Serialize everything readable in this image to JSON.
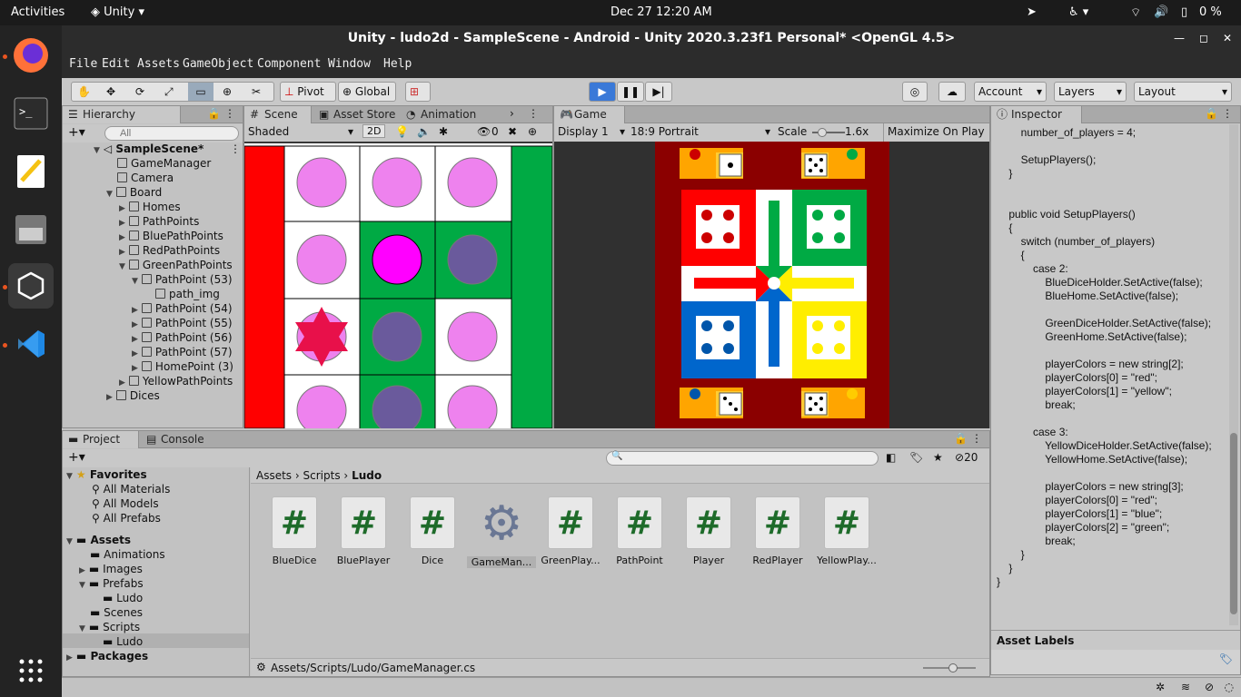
{
  "topbar": {
    "activities": "Activities",
    "app": "Unity",
    "clock": "Dec 27  12:20 AM",
    "battery": "0 %"
  },
  "window": {
    "title": "Unity - ludo2d - SampleScene - Android - Unity 2020.3.23f1 Personal* <OpenGL 4.5>"
  },
  "menu": [
    "File",
    "Edit",
    "Assets",
    "GameObject",
    "Component",
    "Window",
    "Help"
  ],
  "toolbar": {
    "pivot": "Pivot",
    "global": "Global",
    "account": "Account",
    "layers": "Layers",
    "layout": "Layout"
  },
  "hierarchy": {
    "tab": "Hierarchy",
    "search_placeholder": "All",
    "items": [
      "SampleScene*",
      "GameManager",
      "Camera",
      "Board",
      "Homes",
      "PathPoints",
      "BluePathPoints",
      "RedPathPoints",
      "GreenPathPoints",
      "PathPoint (53)",
      "path_img",
      "PathPoint (54)",
      "PathPoint (55)",
      "PathPoint (56)",
      "PathPoint (57)",
      "HomePoint (3)",
      "YellowPathPoints",
      "Dices"
    ]
  },
  "scene": {
    "tabs": [
      "Scene",
      "Asset Store",
      "Animation"
    ],
    "shading": "Shaded",
    "mode2d": "2D",
    "hidden": "0"
  },
  "game": {
    "tab": "Game",
    "display": "Display 1",
    "aspect": "18:9 Portrait",
    "scale_label": "Scale",
    "scale_value": "1.6x",
    "maximize": "Maximize On Play"
  },
  "inspector": {
    "tab": "Inspector",
    "code": [
      "        number_of_players = 4;",
      "",
      "        SetupPlayers();",
      "    }",
      "",
      "",
      "    public void SetupPlayers()",
      "    {",
      "        switch (number_of_players)",
      "        {",
      "            case 2:",
      "                BlueDiceHolder.SetActive(false);",
      "                BlueHome.SetActive(false);",
      "",
      "                GreenDiceHolder.SetActive(false);",
      "                GreenHome.SetActive(false);",
      "",
      "                playerColors = new string[2];",
      "                playerColors[0] = \"red\";",
      "                playerColors[1] = \"yellow\";",
      "                break;",
      "",
      "            case 3:",
      "                YellowDiceHolder.SetActive(false);",
      "                YellowHome.SetActive(false);",
      "",
      "                playerColors = new string[3];",
      "                playerColors[0] = \"red\";",
      "                playerColors[1] = \"blue\";",
      "                playerColors[2] = \"green\";",
      "                break;",
      "        }",
      "    }",
      "}"
    ],
    "asset_labels": "Asset Labels"
  },
  "project": {
    "tabs": [
      "Project",
      "Console"
    ],
    "hidden_count": "20",
    "favorites": "Favorites",
    "fav_items": [
      "All Materials",
      "All Models",
      "All Prefabs"
    ],
    "assets": "Assets",
    "asset_items": [
      "Animations",
      "Images",
      "Prefabs",
      "Ludo",
      "Scenes",
      "Scripts",
      "Ludo"
    ],
    "packages": "Packages",
    "breadcrumb": [
      "Assets",
      "Scripts",
      "Ludo"
    ],
    "files": [
      "BlueDice",
      "BluePlayer",
      "Dice",
      "GameMan...",
      "GreenPlay...",
      "PathPoint",
      "Player",
      "RedPlayer",
      "YellowPlay..."
    ],
    "path": "Assets/Scripts/Ludo/GameManager.cs"
  },
  "colors": {
    "red": "#ff0000",
    "green": "#00aa44",
    "blue": "#0066cc",
    "yellow": "#ffee00",
    "board_bg": "#8b0000",
    "accent": "#e95420"
  }
}
